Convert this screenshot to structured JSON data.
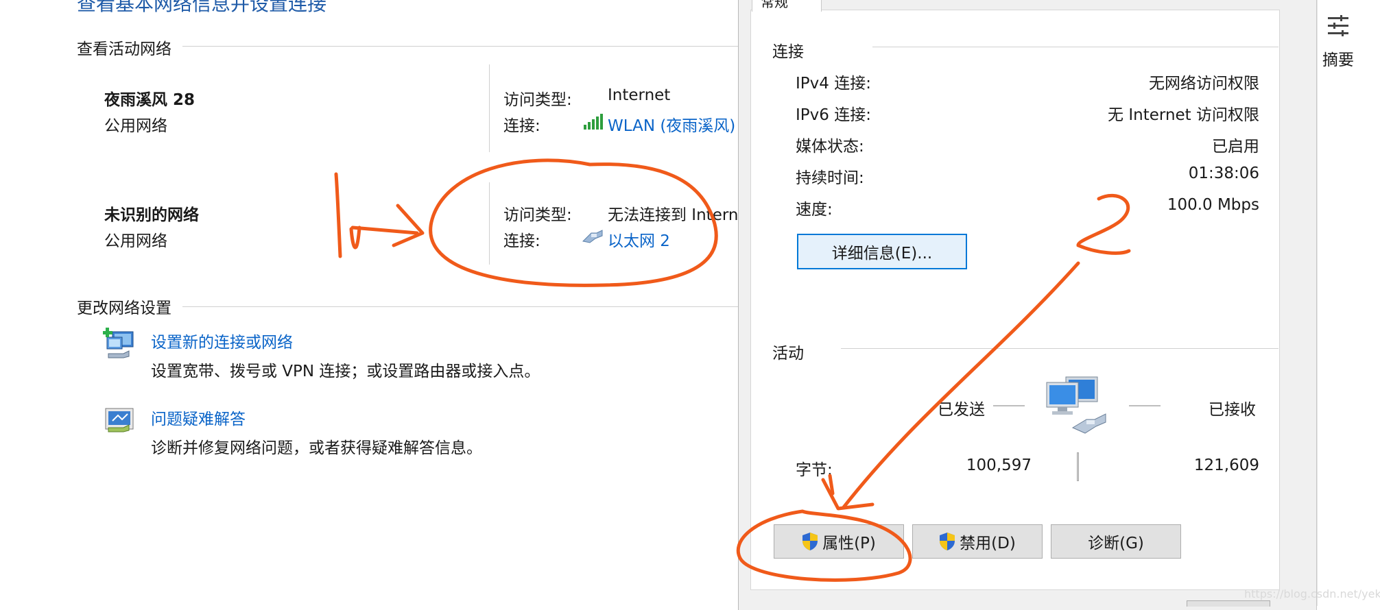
{
  "left": {
    "page_title": "查看基本网络信息并设置连接",
    "active_section": "查看活动网络",
    "networks": [
      {
        "name": "夜雨溪风 28",
        "type": "公用网络",
        "access_label": "访问类型:",
        "access_value": "Internet",
        "conn_label": "连接:",
        "conn_value": "WLAN (夜雨溪风)"
      },
      {
        "name": "未识别的网络",
        "type": "公用网络",
        "access_label": "访问类型:",
        "access_value": "无法连接到 Intern",
        "conn_label": "连接:",
        "conn_value": "以太网 2"
      }
    ],
    "change_section": "更改网络设置",
    "items": [
      {
        "title": "设置新的连接或网络",
        "desc": "设置宽带、拨号或 VPN 连接；或设置路由器或接入点。"
      },
      {
        "title": "问题疑难解答",
        "desc": "诊断并修复网络问题，或者获得疑难解答信息。"
      }
    ]
  },
  "dialog": {
    "tab_label": "常规",
    "connection_section": "连接",
    "rows": [
      {
        "label": "IPv4 连接:",
        "value": "无网络访问权限"
      },
      {
        "label": "IPv6 连接:",
        "value": "无 Internet 访问权限"
      },
      {
        "label": "媒体状态:",
        "value": "已启用"
      },
      {
        "label": "持续时间:",
        "value": "01:38:06"
      },
      {
        "label": "速度:",
        "value": "100.0 Mbps"
      }
    ],
    "details_button": "详细信息(E)...",
    "activity_section": "活动",
    "sent_label": "已发送",
    "received_label": "已接收",
    "bytes_label": "字节:",
    "bytes_sent": "100,597",
    "bytes_received": "121,609",
    "buttons": {
      "properties": "属性(P)",
      "disable": "禁用(D)",
      "diagnose": "诊断(G)"
    }
  },
  "summary": {
    "label": "摘要"
  },
  "annotations": {
    "num1": "1",
    "num2": "2"
  },
  "watermark": "https://blog.csdn.net/yekuzi",
  "colors": {
    "link": "#0a64c8",
    "annotation": "#f05a1a",
    "focus_border": "#0078d7"
  },
  "icons": [
    "wifi-signal-icon",
    "ethernet-icon",
    "new-connection-icon",
    "troubleshoot-icon",
    "shield-icon",
    "network-computers-icon",
    "summary-list-icon"
  ]
}
